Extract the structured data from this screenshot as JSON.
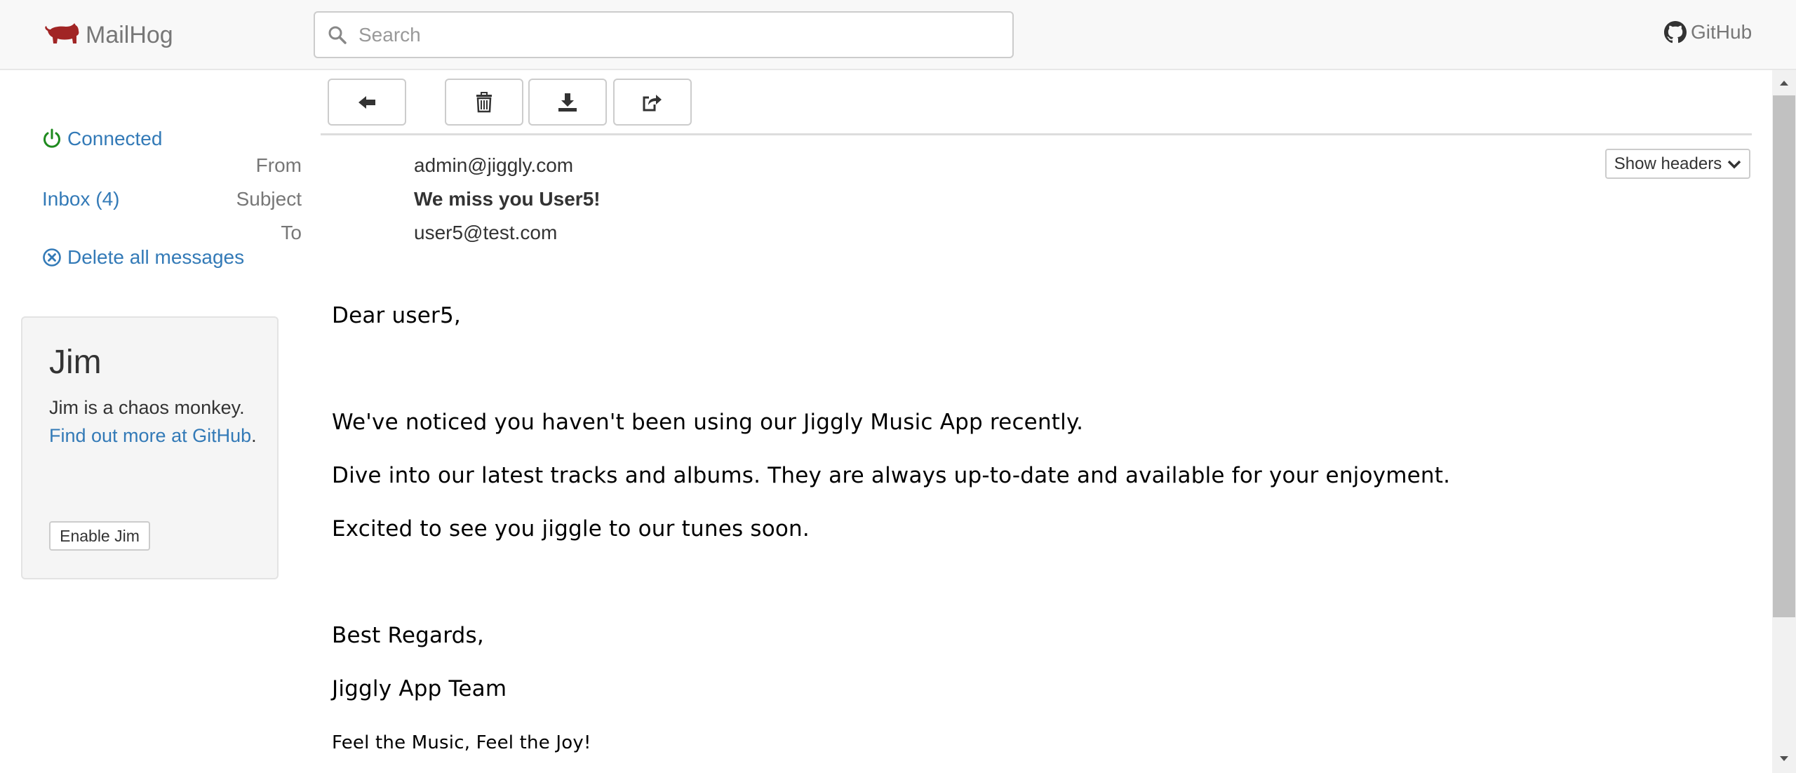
{
  "app": {
    "name": "MailHog",
    "github_label": "GitHub"
  },
  "search": {
    "placeholder": "Search",
    "value": ""
  },
  "sidebar": {
    "connected_label": "Connected",
    "inbox_label": "Inbox (4)",
    "delete_all_label": "Delete all messages",
    "status_color": "#1e8a1e",
    "link_color": "#337ab7"
  },
  "jim": {
    "title": "Jim",
    "description": "Jim is a chaos monkey.",
    "find_out_text": "Find out more at",
    "github_link_text": "GitHub",
    "period": ".",
    "enable_button": "Enable Jim"
  },
  "toolbar": {
    "back_icon": "arrow-left-icon",
    "delete_icon": "trash-icon",
    "download_icon": "download-icon",
    "release_icon": "share-icon"
  },
  "message": {
    "headers": {
      "from_label": "From",
      "from_value": "admin@jiggly.com",
      "subject_label": "Subject",
      "subject_value": "We miss you User5!",
      "to_label": "To",
      "to_value": "user5@test.com"
    },
    "show_headers_label": "Show headers",
    "body": {
      "greeting": "Dear user5,",
      "line1": "We've noticed you haven't been using our Jiggly Music App recently.",
      "line2": "Dive into our latest tracks and albums. They are always up-to-date and available for your enjoyment.",
      "line3": "Excited to see you jiggle to our tunes soon.",
      "closing": "Best Regards,",
      "signature": "Jiggly App Team",
      "tagline": "Feel the Music, Feel the Joy!"
    }
  }
}
